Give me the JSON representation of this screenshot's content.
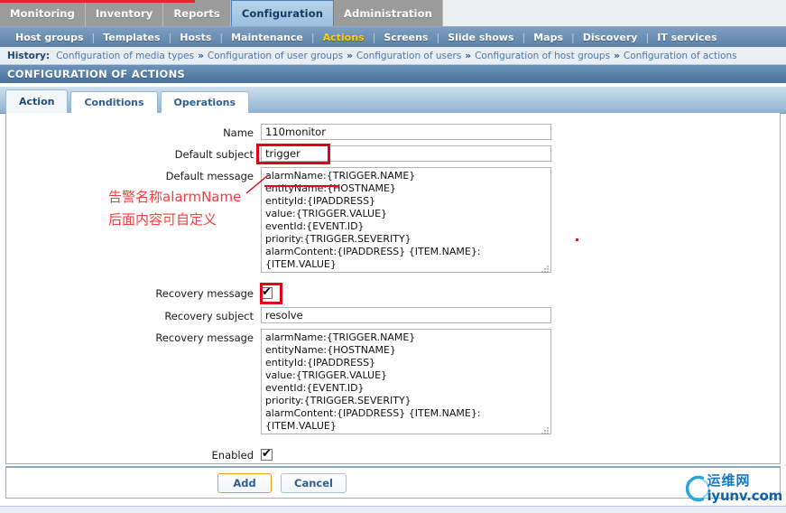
{
  "main_nav": {
    "items": [
      {
        "label": "Monitoring",
        "active": false
      },
      {
        "label": "Inventory",
        "active": false
      },
      {
        "label": "Reports",
        "active": false
      },
      {
        "label": "Configuration",
        "active": true
      },
      {
        "label": "Administration",
        "active": false
      }
    ]
  },
  "sub_nav": {
    "items": [
      {
        "label": "Host groups",
        "current": false
      },
      {
        "label": "Templates",
        "current": false
      },
      {
        "label": "Hosts",
        "current": false
      },
      {
        "label": "Maintenance",
        "current": false
      },
      {
        "label": "Actions",
        "current": true
      },
      {
        "label": "Screens",
        "current": false
      },
      {
        "label": "Slide shows",
        "current": false
      },
      {
        "label": "Maps",
        "current": false
      },
      {
        "label": "Discovery",
        "current": false
      },
      {
        "label": "IT services",
        "current": false
      }
    ],
    "separator": "|"
  },
  "history": {
    "label": "History:",
    "separator": "»",
    "items": [
      "Configuration of media types",
      "Configuration of user groups",
      "Configuration of users",
      "Configuration of host groups",
      "Configuration of actions"
    ]
  },
  "page_header": {
    "title": "CONFIGURATION OF ACTIONS"
  },
  "tabs": [
    {
      "label": "Action",
      "active": true
    },
    {
      "label": "Conditions",
      "active": false
    },
    {
      "label": "Operations",
      "active": false
    }
  ],
  "form": {
    "name": {
      "label": "Name",
      "value": "110monitor"
    },
    "default_subject": {
      "label": "Default subject",
      "value": "trigger"
    },
    "default_message": {
      "label": "Default message",
      "value": "alarmName:{TRIGGER.NAME}\nentityName:{HOSTNAME}\nentityId:{IPADDRESS}\nvalue:{TRIGGER.VALUE}\neventId:{EVENT.ID}\npriority:{TRIGGER.SEVERITY}\nalarmContent:{IPADDRESS} {ITEM.NAME}:\n{ITEM.VALUE}"
    },
    "recovery_message_toggle": {
      "label": "Recovery message",
      "checked": true
    },
    "recovery_subject": {
      "label": "Recovery subject",
      "value": "resolve"
    },
    "recovery_message": {
      "label": "Recovery message",
      "value": "alarmName:{TRIGGER.NAME}\nentityName:{HOSTNAME}\nentityId:{IPADDRESS}\nvalue:{TRIGGER.VALUE}\neventId:{EVENT.ID}\npriority:{TRIGGER.SEVERITY}\nalarmContent:{IPADDRESS} {ITEM.NAME}:\n{ITEM.VALUE}"
    },
    "enabled": {
      "label": "Enabled",
      "checked": true
    }
  },
  "footer": {
    "add_label": "Add",
    "cancel_label": "Cancel"
  },
  "annotation": {
    "line1": "告警名称alarmName",
    "line2": "后面内容可自定义",
    "color": "#fb3b3b",
    "highlight_color": "#e2001a"
  },
  "watermark": {
    "cn": "运维网",
    "en": "iyunv.com",
    "color": "#1777c4"
  }
}
